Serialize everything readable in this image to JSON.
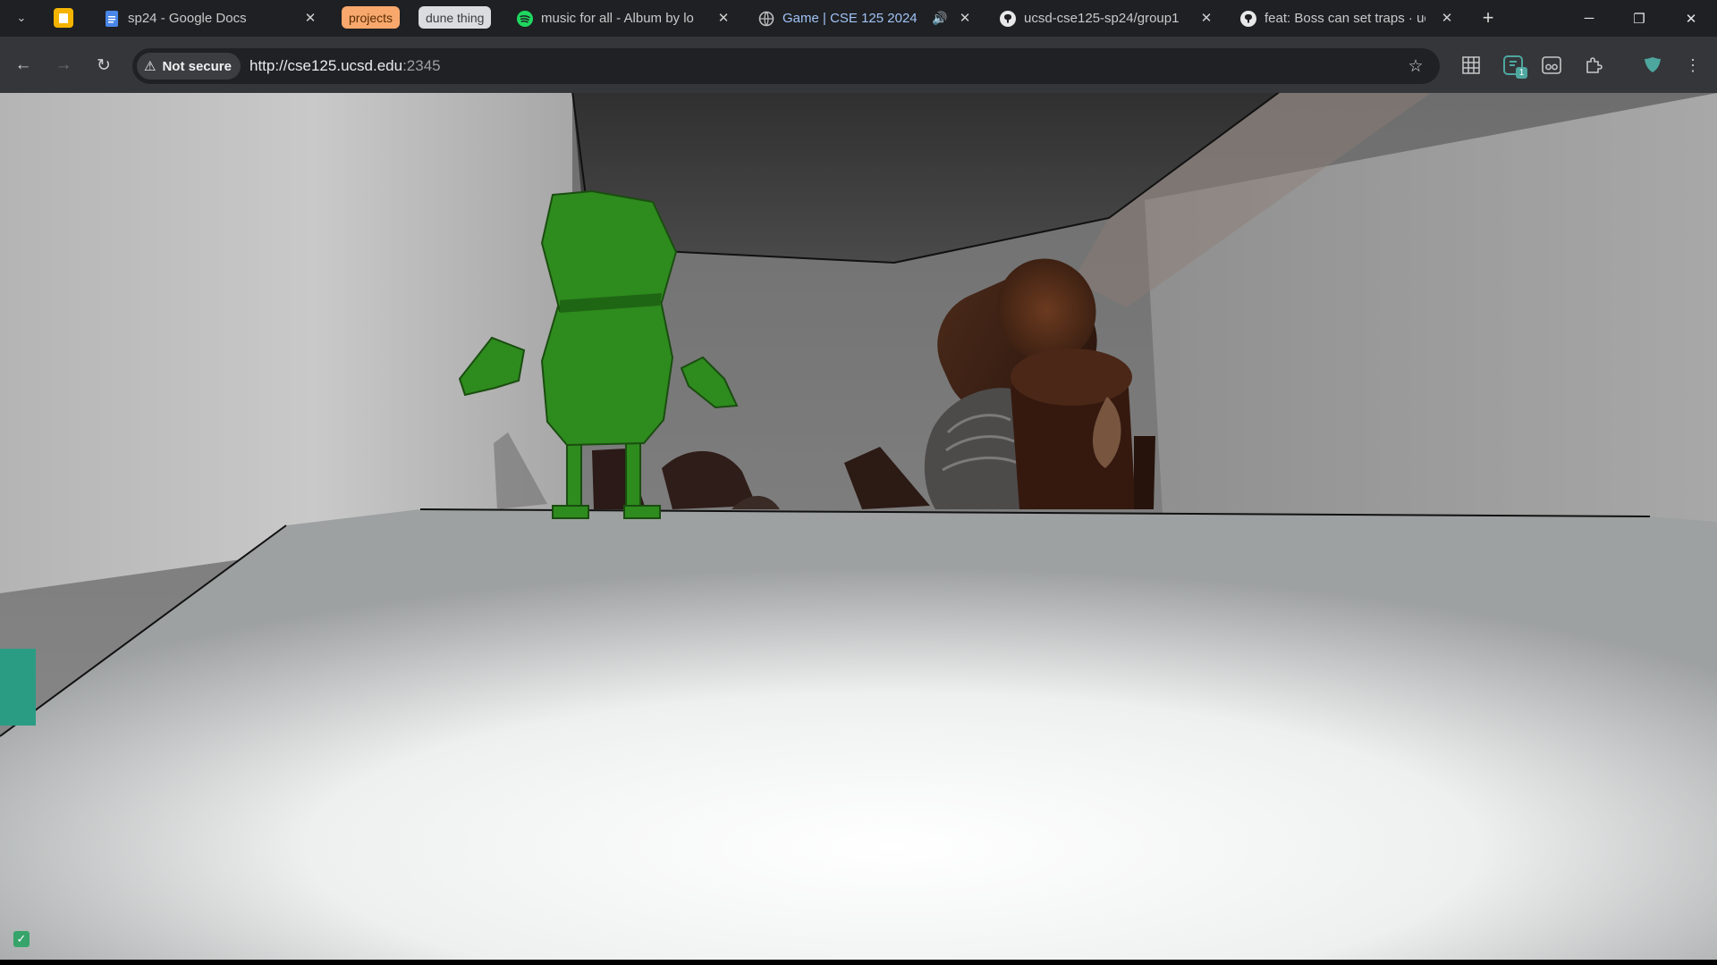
{
  "browser": {
    "tabs": [
      {
        "title": "sp24 - Google Docs",
        "icon": "google-docs-icon",
        "closable": true
      },
      {
        "title": "music for all - Album by lo",
        "icon": "spotify-icon",
        "closable": true
      },
      {
        "title": "Game | CSE 125 2024",
        "icon": "globe-icon",
        "active": true,
        "audio": true,
        "closable": true
      },
      {
        "title": "ucsd-cse125-sp24/group1",
        "icon": "github-icon",
        "closable": true
      },
      {
        "title": "feat: Boss can set traps · uc",
        "icon": "github-icon",
        "closable": true
      }
    ],
    "pinned_tab_icon": "google-keep-icon",
    "tab_groups": [
      {
        "label": "projects",
        "color": "#f8a86c"
      },
      {
        "label": "dune thing",
        "color": "#dadce0"
      }
    ],
    "new_tab_label": "+",
    "window_controls": [
      "minimize",
      "restore",
      "close"
    ]
  },
  "toolbar": {
    "security_label": "Not secure",
    "url_main": "http://cse125.ucsd.edu",
    "url_rest": ":2345",
    "extension_badge": "1",
    "extensions": [
      "grid-icon",
      "extension-badge-icon",
      "reader-icon",
      "puzzle-icon",
      "shield-icon"
    ]
  },
  "game": {
    "scene": "3D room with green player character facing a dark wooden log trap",
    "colors": {
      "player": "#2e8b1e",
      "player_dark": "#1f6614",
      "floor_light": "#ffffff",
      "floor_edge": "#cfd2d2",
      "log": "#3a1f14",
      "accent_block": "#2b9c84"
    },
    "status_indicator": "checkbox-checked"
  }
}
